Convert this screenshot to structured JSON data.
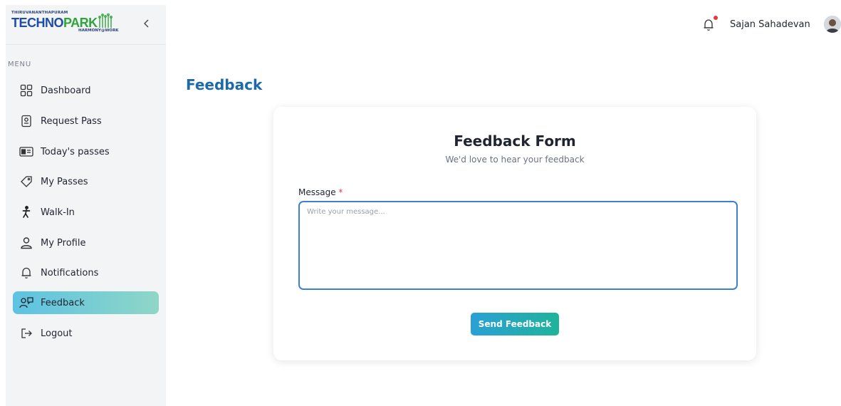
{
  "brand": {
    "top_text": "THIRUVANANTHAPURAM",
    "main_text_a": "TECHNO",
    "main_text_b": "PARK",
    "sub_text": "HARMONY@WORK",
    "colors": {
      "techno": "#1e4da8",
      "park": "#2fa33c"
    }
  },
  "sidebar": {
    "menu_label": "MENU",
    "items": [
      {
        "label": "Dashboard",
        "icon": "grid-icon"
      },
      {
        "label": "Request Pass",
        "icon": "pass-icon"
      },
      {
        "label": "Today's passes",
        "icon": "id-card-icon"
      },
      {
        "label": "My Passes",
        "icon": "ticket-icon"
      },
      {
        "label": "Walk-In",
        "icon": "walk-icon"
      },
      {
        "label": "My Profile",
        "icon": "user-icon"
      },
      {
        "label": "Notifications",
        "icon": "bell-icon"
      },
      {
        "label": "Feedback",
        "icon": "feedback-icon",
        "active": true
      },
      {
        "label": "Logout",
        "icon": "logout-icon"
      }
    ]
  },
  "header": {
    "user_name": "Sajan Sahadevan",
    "notification_dot_color": "#e23b3b"
  },
  "main": {
    "page_title": "Feedback",
    "form": {
      "title": "Feedback Form",
      "subtitle": "We'd love to hear your feedback",
      "message_label": "Message",
      "required_mark": "*",
      "message_placeholder": "Write your message...",
      "message_value": "",
      "submit_label": "Send Feedback"
    }
  },
  "colors": {
    "accent": "#1c6aa8",
    "input_border": "#3c7fd7",
    "active_nav_from": "#5cc3e3",
    "active_nav_to": "#8fd6c6"
  }
}
